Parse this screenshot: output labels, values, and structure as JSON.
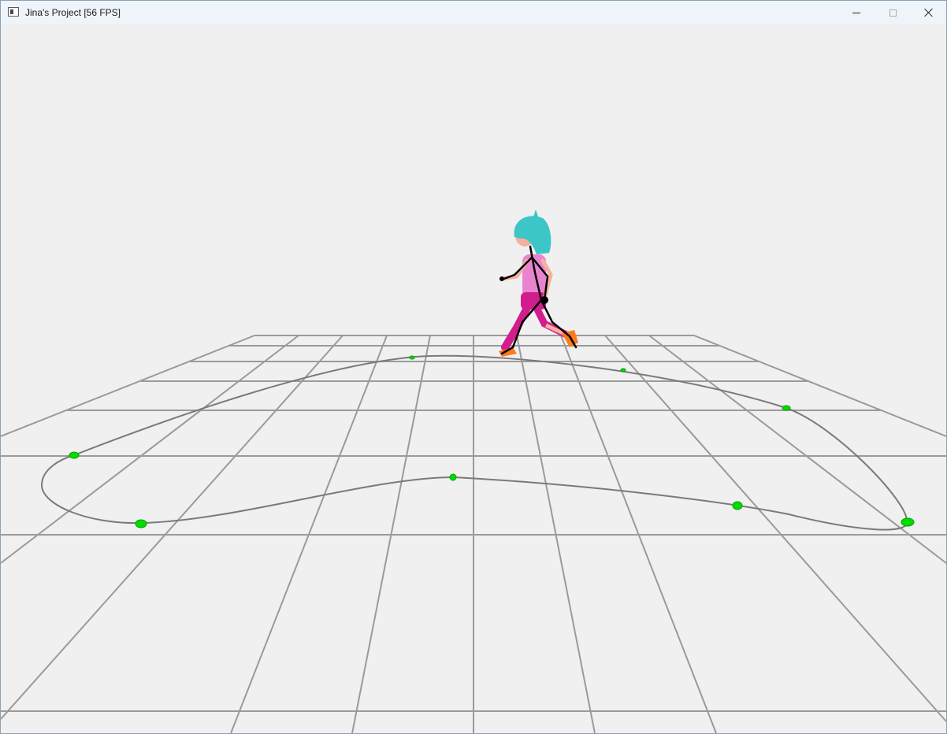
{
  "window": {
    "title": "Jina's Project [56 FPS]",
    "controls": [
      "minimize",
      "maximize",
      "close"
    ]
  },
  "scene": {
    "background_color": "#f0f0f0",
    "grid_color": "#9a9a9a",
    "path_color": "#7a7a7a",
    "control_point_color": "#00dd00",
    "character": {
      "hair_color": "#3cc6c8",
      "shirt_color": "#e884cf",
      "pants_color": "#d21e8c",
      "shoe_color": "#ff7a1a",
      "skin_color": "#f5b0a0",
      "skeleton_color": "#000000"
    }
  }
}
